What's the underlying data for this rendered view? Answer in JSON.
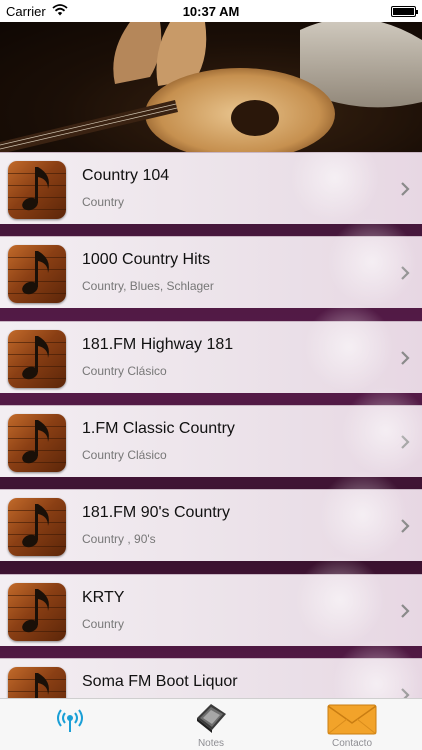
{
  "status_bar": {
    "carrier": "Carrier",
    "time": "10:37 AM",
    "battery_level": 1.0
  },
  "header": {
    "image_icon": "guitar-boots-hat-photo"
  },
  "stations": [
    {
      "title": "Country 104",
      "genre": "Country"
    },
    {
      "title": "1000 Country Hits",
      "genre": "Country, Blues, Schlager"
    },
    {
      "title": "181.FM Highway 181",
      "genre": "Country Clásico"
    },
    {
      "title": "1.FM Classic Country",
      "genre": "Country Clásico"
    },
    {
      "title": "181.FM 90's Country",
      "genre": "Country , 90's"
    },
    {
      "title": "KRTY",
      "genre": "Country"
    },
    {
      "title": "Soma FM Boot Liquor",
      "genre": ""
    }
  ],
  "tab_bar": {
    "tabs": [
      {
        "label": "",
        "icon": "radio-antenna-icon",
        "active": true
      },
      {
        "label": "Notes",
        "icon": "notes-icon",
        "active": false
      },
      {
        "label": "Contacto",
        "icon": "envelope-icon",
        "active": false
      }
    ]
  },
  "colors": {
    "accent": "#1a9fd6",
    "list_background": "#5a1c4c",
    "row_background": "#f3eef2"
  }
}
